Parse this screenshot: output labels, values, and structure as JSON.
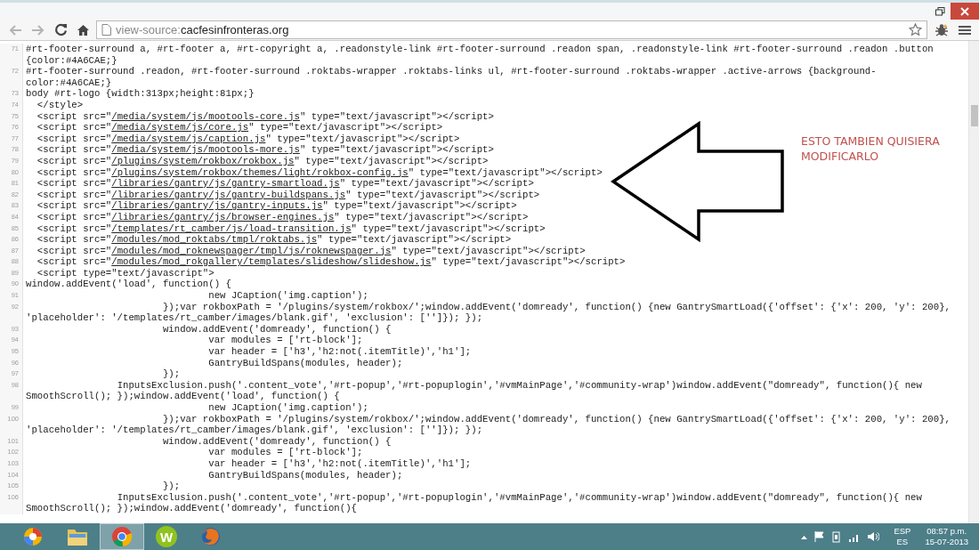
{
  "address": {
    "prefix": "view-source:",
    "host": "cacfesinfronteras.org"
  },
  "source_lines": [
    {
      "number": "71",
      "parts": [
        {
          "text": "#rt-footer-surround a, #rt-footer a, #rt-copyright a, .readonstyle-link #rt-footer-surround .readon span, .readonstyle-link #rt-footer-surround .readon .button {color:#4A6CAE;}"
        }
      ]
    },
    {
      "number": "72",
      "parts": [
        {
          "text": "#rt-footer-surround .readon, #rt-footer-surround .roktabs-wrapper .roktabs-links ul, #rt-footer-surround .roktabs-wrapper .active-arrows {background-color:#4A6CAE;}"
        }
      ]
    },
    {
      "number": "73",
      "parts": [
        {
          "text": "body #rt-logo {width:313px;height:81px;}"
        }
      ]
    },
    {
      "number": "74",
      "parts": [
        {
          "text": "  </style>"
        }
      ]
    },
    {
      "number": "75",
      "parts": [
        {
          "text": "  <script src=\""
        },
        {
          "text": "/media/system/js/mootools-core.js",
          "link": true
        },
        {
          "text": "\" type=\"text/javascript\"></script>"
        }
      ]
    },
    {
      "number": "76",
      "parts": [
        {
          "text": "  <script src=\""
        },
        {
          "text": "/media/system/js/core.js",
          "link": true
        },
        {
          "text": "\" type=\"text/javascript\"></script>"
        }
      ]
    },
    {
      "number": "77",
      "parts": [
        {
          "text": "  <script src=\""
        },
        {
          "text": "/media/system/js/caption.js",
          "link": true
        },
        {
          "text": "\" type=\"text/javascript\"></script>"
        }
      ]
    },
    {
      "number": "78",
      "parts": [
        {
          "text": "  <script src=\""
        },
        {
          "text": "/media/system/js/mootools-more.js",
          "link": true
        },
        {
          "text": "\" type=\"text/javascript\"></script>"
        }
      ]
    },
    {
      "number": "79",
      "parts": [
        {
          "text": "  <script src=\""
        },
        {
          "text": "/plugins/system/rokbox/rokbox.js",
          "link": true
        },
        {
          "text": "\" type=\"text/javascript\"></script>"
        }
      ]
    },
    {
      "number": "80",
      "parts": [
        {
          "text": "  <script src=\""
        },
        {
          "text": "/plugins/system/rokbox/themes/light/rokbox-config.js",
          "link": true
        },
        {
          "text": "\" type=\"text/javascript\"></script>"
        }
      ]
    },
    {
      "number": "81",
      "parts": [
        {
          "text": "  <script src=\""
        },
        {
          "text": "/libraries/gantry/js/gantry-smartload.js",
          "link": true
        },
        {
          "text": "\" type=\"text/javascript\"></script>"
        }
      ]
    },
    {
      "number": "82",
      "parts": [
        {
          "text": "  <script src=\""
        },
        {
          "text": "/libraries/gantry/js/gantry-buildspans.js",
          "link": true
        },
        {
          "text": "\" type=\"text/javascript\"></script>"
        }
      ]
    },
    {
      "number": "83",
      "parts": [
        {
          "text": "  <script src=\""
        },
        {
          "text": "/libraries/gantry/js/gantry-inputs.js",
          "link": true
        },
        {
          "text": "\" type=\"text/javascript\"></script>"
        }
      ]
    },
    {
      "number": "84",
      "parts": [
        {
          "text": "  <script src=\""
        },
        {
          "text": "/libraries/gantry/js/browser-engines.js",
          "link": true
        },
        {
          "text": "\" type=\"text/javascript\"></script>"
        }
      ]
    },
    {
      "number": "85",
      "parts": [
        {
          "text": "  <script src=\""
        },
        {
          "text": "/templates/rt_camber/js/load-transition.js",
          "link": true
        },
        {
          "text": "\" type=\"text/javascript\"></script>"
        }
      ]
    },
    {
      "number": "86",
      "parts": [
        {
          "text": "  <script src=\""
        },
        {
          "text": "/modules/mod_roktabs/tmpl/roktabs.js",
          "link": true
        },
        {
          "text": "\" type=\"text/javascript\"></script>"
        }
      ]
    },
    {
      "number": "87",
      "parts": [
        {
          "text": "  <script src=\""
        },
        {
          "text": "/modules/mod_roknewspager/tmpl/js/roknewspager.js",
          "link": true
        },
        {
          "text": "\" type=\"text/javascript\"></script>"
        }
      ]
    },
    {
      "number": "88",
      "parts": [
        {
          "text": "  <script src=\""
        },
        {
          "text": "/modules/mod_rokgallery/templates/slideshow/slideshow.js",
          "link": true
        },
        {
          "text": "\" type=\"text/javascript\"></script>"
        }
      ]
    },
    {
      "number": "89",
      "parts": [
        {
          "text": "  <script type=\"text/javascript\">"
        }
      ]
    },
    {
      "number": "90",
      "parts": [
        {
          "text": "window.addEvent('load', function() {"
        }
      ]
    },
    {
      "number": "91",
      "parts": [
        {
          "text": "\t\t\t\tnew JCaption('img.caption');"
        }
      ]
    },
    {
      "number": "92",
      "parts": [
        {
          "text": "\t\t\t});var rokboxPath = '/plugins/system/rokbox/';window.addEvent('domready', function() {new GantrySmartLoad({'offset': {'x': 200, 'y': 200}, 'placeholder': '/templates/rt_camber/images/blank.gif', 'exclusion': ['']}); });"
        }
      ]
    },
    {
      "number": "93",
      "parts": [
        {
          "text": "\t\t\twindow.addEvent('domready', function() {"
        }
      ]
    },
    {
      "number": "94",
      "parts": [
        {
          "text": "\t\t\t\tvar modules = ['rt-block'];"
        }
      ]
    },
    {
      "number": "95",
      "parts": [
        {
          "text": "\t\t\t\tvar header = ['h3','h2:not(.itemTitle)','h1'];"
        }
      ]
    },
    {
      "number": "96",
      "parts": [
        {
          "text": "\t\t\t\tGantryBuildSpans(modules, header);"
        }
      ]
    },
    {
      "number": "97",
      "parts": [
        {
          "text": "\t\t\t});"
        }
      ]
    },
    {
      "number": "98",
      "parts": [
        {
          "text": "\t\tInputsExclusion.push('.content_vote','#rt-popup','#rt-popuplogin','#vmMainPage','#community-wrap')window.addEvent(\"domready\", function(){ new SmoothScroll(); });window.addEvent('load', function() {"
        }
      ]
    },
    {
      "number": "99",
      "parts": [
        {
          "text": "\t\t\t\tnew JCaption('img.caption');"
        }
      ]
    },
    {
      "number": "100",
      "parts": [
        {
          "text": "\t\t\t});var rokboxPath = '/plugins/system/rokbox/';window.addEvent('domready', function() {new GantrySmartLoad({'offset': {'x': 200, 'y': 200}, 'placeholder': '/templates/rt_camber/images/blank.gif', 'exclusion': ['']}); });"
        }
      ]
    },
    {
      "number": "101",
      "parts": [
        {
          "text": "\t\t\twindow.addEvent('domready', function() {"
        }
      ]
    },
    {
      "number": "102",
      "parts": [
        {
          "text": "\t\t\t\tvar modules = ['rt-block'];"
        }
      ]
    },
    {
      "number": "103",
      "parts": [
        {
          "text": "\t\t\t\tvar header = ['h3','h2:not(.itemTitle)','h1'];"
        }
      ]
    },
    {
      "number": "104",
      "parts": [
        {
          "text": "\t\t\t\tGantryBuildSpans(modules, header);"
        }
      ]
    },
    {
      "number": "105",
      "parts": [
        {
          "text": "\t\t\t});"
        }
      ]
    },
    {
      "number": "106",
      "parts": [
        {
          "text": "\t\tInputsExclusion.push('.content_vote','#rt-popup','#rt-popuplogin','#vmMainPage','#community-wrap')window.addEvent(\"domready\", function(){ new SmoothScroll(); });window.addEvent('domready', function(){"
        }
      ]
    }
  ],
  "annotation": {
    "text": "ESTO TAMBIEN QUISIERA MODIFICARLO",
    "color": "#c0504d"
  },
  "taskbar": {
    "apps": [
      {
        "kind": "swirl",
        "selected": false
      },
      {
        "kind": "folder",
        "selected": false
      },
      {
        "kind": "browser",
        "selected": true
      },
      {
        "kind": "letter",
        "label": "W",
        "selected": false
      },
      {
        "kind": "fox",
        "selected": false
      }
    ],
    "language": "ESP",
    "layout": "ES",
    "time": "08:57 p.m.",
    "date": "15-07-2013"
  }
}
